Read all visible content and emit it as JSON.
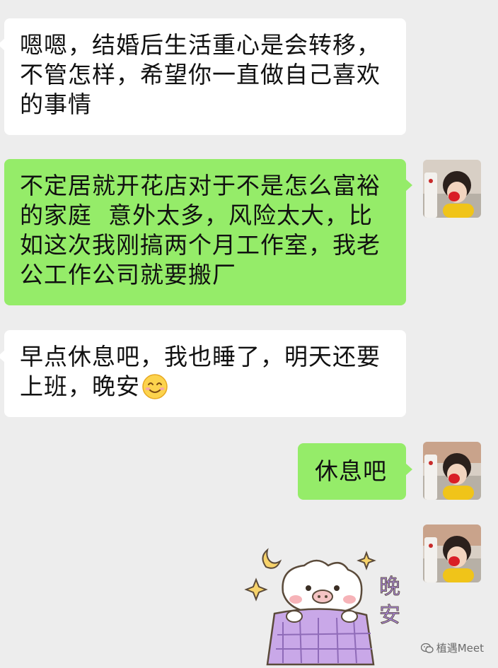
{
  "messages": [
    {
      "from": "other",
      "text": "嗯嗯，结婚后生活重心是会转移，\n不管怎样，希望你一直做自己喜欢\n的事情"
    },
    {
      "from": "me",
      "text": "不定居就开花店对于不是怎么富裕\n的家庭  意外太多，风险太大，比\n如这次我刚搞两个月工作室，我老\n公工作公司就要搬厂"
    },
    {
      "from": "other",
      "text": "早点休息吧，我也睡了，明天还要\n上班，晚安"
    },
    {
      "from": "me",
      "text": "休息吧"
    },
    {
      "from": "me",
      "sticker_text": "晚\n安"
    }
  ],
  "emoji": "smiling-face-emoji",
  "avatar_icon": "child-photo-avatar-icon",
  "watermark": {
    "icon": "wechat-official-account-icon",
    "text": "植遇Meet"
  },
  "colors": {
    "background": "#ededed",
    "bubble_in": "#ffffff",
    "bubble_out": "#95ec69"
  }
}
